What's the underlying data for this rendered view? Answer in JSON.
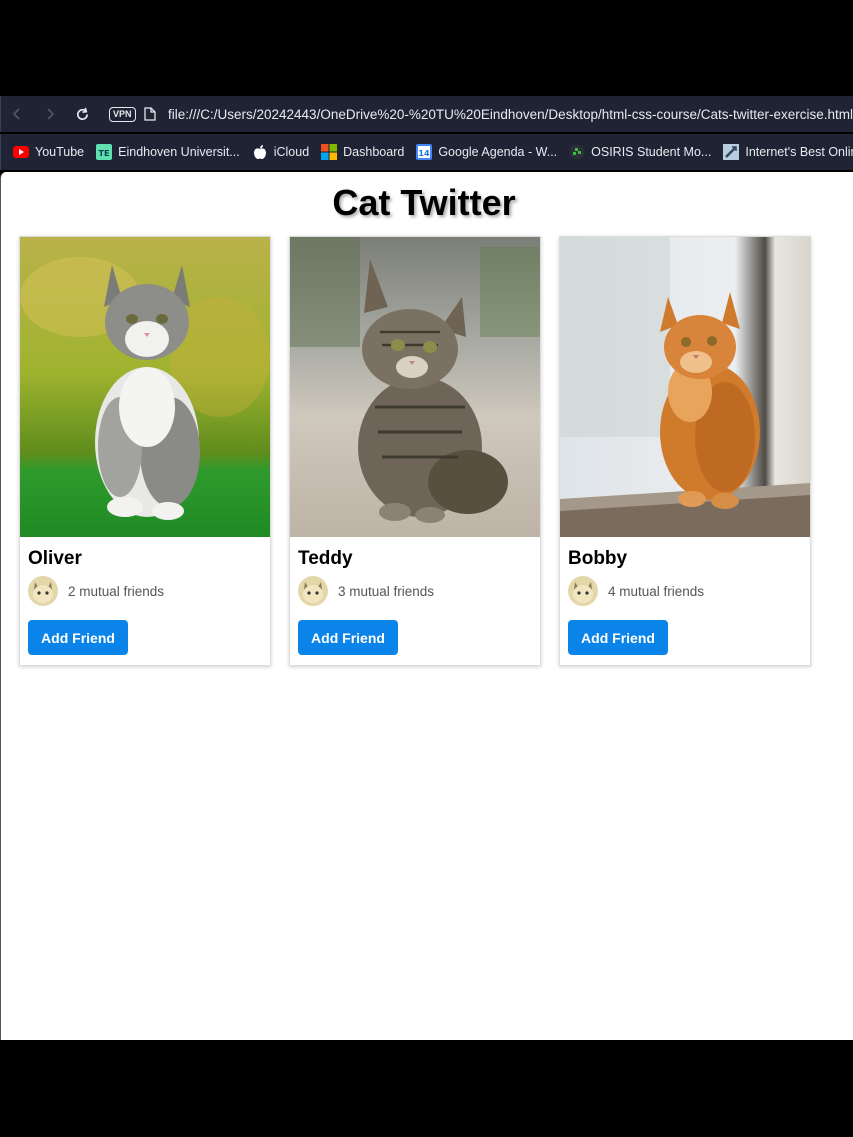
{
  "browser": {
    "url": "file:///C:/Users/20242443/OneDrive%20-%20TU%20Eindhoven/Desktop/html-css-course/Cats-twitter-exercise.html",
    "vpn_label": "VPN",
    "bookmarks": [
      {
        "label": "YouTube",
        "icon": "youtube-icon"
      },
      {
        "label": "Eindhoven Universit...",
        "icon": "tue-icon"
      },
      {
        "label": "iCloud",
        "icon": "apple-icon"
      },
      {
        "label": "Dashboard",
        "icon": "microsoft-icon"
      },
      {
        "label": "Google Agenda - W...",
        "icon": "calendar-icon"
      },
      {
        "label": "OSIRIS Student Mo...",
        "icon": "osiris-icon"
      },
      {
        "label": "Internet's Best Onlin...",
        "icon": "website-icon"
      }
    ]
  },
  "page": {
    "title": "Cat Twitter",
    "cards": [
      {
        "name": "Oliver",
        "mutual": "2 mutual friends",
        "button": "Add Friend"
      },
      {
        "name": "Teddy",
        "mutual": "3 mutual friends",
        "button": "Add Friend"
      },
      {
        "name": "Bobby",
        "mutual": "4 mutual friends",
        "button": "Add Friend"
      }
    ]
  },
  "colors": {
    "chrome_bg": "#1f2333",
    "button_bg": "#0a84e8",
    "page_bg": "#ffffff"
  }
}
